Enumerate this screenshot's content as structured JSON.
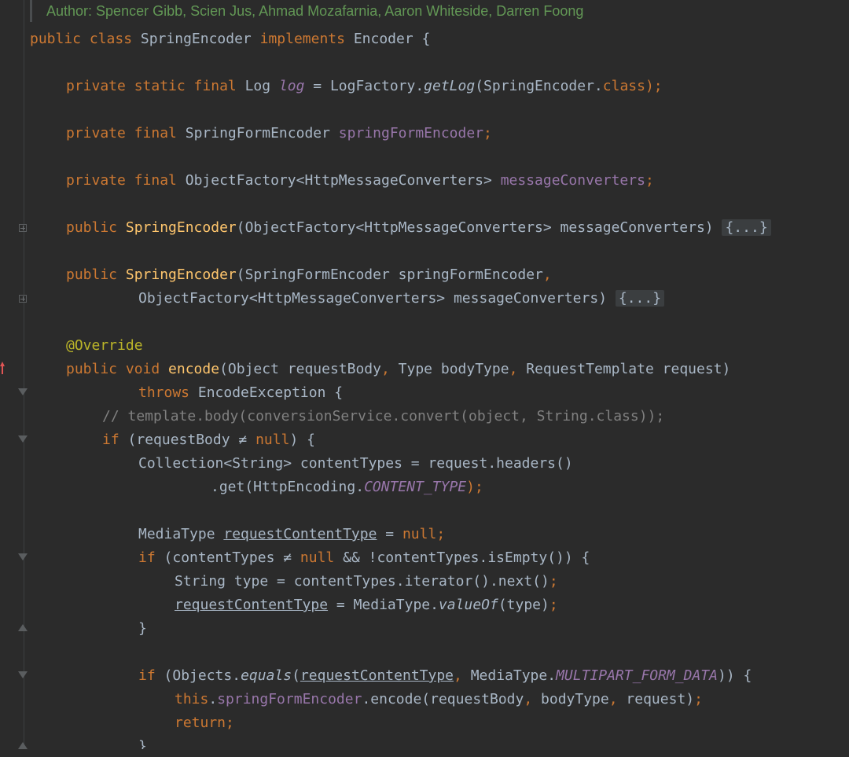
{
  "editor": {
    "language": "java",
    "doc_author": "Author: Spencer Gibb, Scien Jus, Ahmad Mozafarnia, Aaron Whiteside, Darren Foong",
    "colors": {
      "background": "#2b2b2b",
      "keyword": "#cc7832",
      "default_text": "#a9b7c6",
      "field": "#9876aa",
      "method_declaration": "#ffc66d",
      "annotation": "#bbb529",
      "comment": "#808080",
      "doc_comment": "#629755"
    },
    "lines": {
      "l1": {
        "t1": "public class",
        "t2": " SpringEncoder ",
        "t3": "implements",
        "t4": " Encoder {"
      },
      "l2": {
        "t1": "private static final",
        "t2": " Log ",
        "t3": "log",
        "t4": " = LogFactory.",
        "t5": "getLog",
        "t6": "(SpringEncoder.",
        "t7": "class",
        "t8": ");"
      },
      "l3": {
        "t1": "private final",
        "t2": " SpringFormEncoder ",
        "t3": "springFormEncoder",
        "t4": ";"
      },
      "l4": {
        "t1": "private final",
        "t2": " ObjectFactory<HttpMessageConverters> ",
        "t3": "messageConverters",
        "t4": ";"
      },
      "l5": {
        "t1": "public ",
        "t2": "SpringEncoder",
        "t3": "(ObjectFactory<HttpMessageConverters> messageConverters) ",
        "t4": "{...}"
      },
      "l6": {
        "t1": "public ",
        "t2": "SpringEncoder",
        "t3": "(SpringFormEncoder springFormEncoder",
        "t4": ","
      },
      "l7": {
        "t1": "ObjectFactory<HttpMessageConverters> messageConverters) ",
        "t2": "{...}"
      },
      "l8": {
        "t1": "@Override"
      },
      "l9": {
        "t1": "public void ",
        "t2": "encode",
        "t3": "(Object requestBody",
        "t4": ", ",
        "t5": "Type bodyType",
        "t6": ", ",
        "t7": "RequestTemplate request)"
      },
      "l10": {
        "t1": "throws",
        "t2": " EncodeException {"
      },
      "l11": {
        "t1": "// template.body(conversionService.convert(object, String.class));"
      },
      "l12": {
        "t1": "if",
        "t2": " (requestBody ≠ ",
        "t3": "null",
        "t4": ") {"
      },
      "l13": {
        "t1": "Collection<String> contentTypes = request.headers()"
      },
      "l14": {
        "t1": ".get(HttpEncoding.",
        "t2": "CONTENT_TYPE",
        "t3": ");"
      },
      "l15": {
        "t1": "MediaType ",
        "t2": "requestContentType",
        "t3": " = ",
        "t4": "null",
        "t5": ";"
      },
      "l16": {
        "t1": "if",
        "t2": " (contentTypes ≠ ",
        "t3": "null",
        "t4": " && !contentTypes.isEmpty()) {"
      },
      "l17": {
        "t1": "String type = contentTypes.iterator().next()",
        "t2": ";"
      },
      "l18": {
        "t1": "requestContentType",
        "t2": " = MediaType.",
        "t3": "valueOf",
        "t4": "(type)",
        "t5": ";"
      },
      "l19": {
        "t1": "}"
      },
      "l20": {
        "t1": "if",
        "t2": " (Objects.",
        "t3": "equals",
        "t4": "(",
        "t5": "requestContentType",
        "t6": ", ",
        "t7": "MediaType.",
        "t8": "MULTIPART_FORM_DATA",
        "t9": ")) {"
      },
      "l21": {
        "t1": "this",
        "t2": ".",
        "t3": "springFormEncoder",
        "t4": ".encode(requestBody",
        "t5": ", ",
        "t6": "bodyType",
        "t7": ", ",
        "t8": "request)",
        "t9": ";"
      },
      "l22": {
        "t1": "return",
        "t2": ";"
      },
      "l23": {
        "t1": "}"
      }
    }
  }
}
